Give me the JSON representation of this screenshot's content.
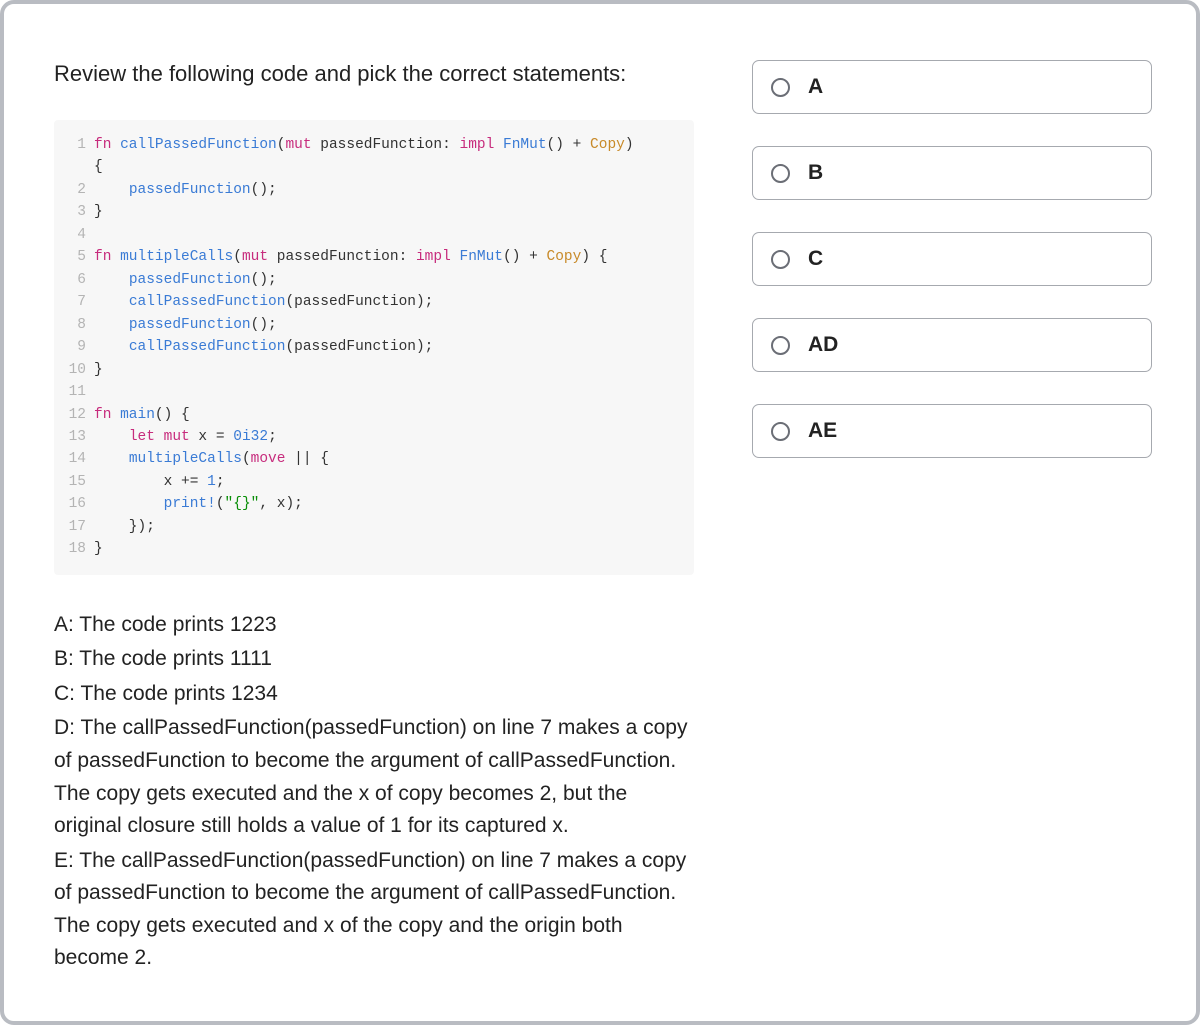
{
  "question": "Review the following code and pick the correct statements:",
  "code": {
    "lines": [
      {
        "n": 1,
        "html": "<span class='kw'>fn</span> <span class='fnname'>callPassedFunction</span>(<span class='kw'>mut</span> <span class='plain'>passedFunction</span>: <span class='kw'>impl</span> <span class='fnname'>FnMut</span>() + <span class='type'>Copy</span>)"
      },
      {
        "n": "",
        "html": "{"
      },
      {
        "n": 2,
        "html": "    <span class='call'>passedFunction</span>();"
      },
      {
        "n": 3,
        "html": "}"
      },
      {
        "n": 4,
        "html": ""
      },
      {
        "n": 5,
        "html": "<span class='kw'>fn</span> <span class='fnname'>multipleCalls</span>(<span class='kw'>mut</span> <span class='plain'>passedFunction</span>: <span class='kw'>impl</span> <span class='fnname'>FnMut</span>() + <span class='type'>Copy</span>) {"
      },
      {
        "n": 6,
        "html": "    <span class='call'>passedFunction</span>();"
      },
      {
        "n": 7,
        "html": "    <span class='call'>callPassedFunction</span>(<span class='plain'>passedFunction</span>);"
      },
      {
        "n": 8,
        "html": "    <span class='call'>passedFunction</span>();"
      },
      {
        "n": 9,
        "html": "    <span class='call'>callPassedFunction</span>(<span class='plain'>passedFunction</span>);"
      },
      {
        "n": 10,
        "html": "}"
      },
      {
        "n": 11,
        "html": ""
      },
      {
        "n": 12,
        "html": "<span class='kw'>fn</span> <span class='fnname'>main</span>() {"
      },
      {
        "n": 13,
        "html": "    <span class='kw'>let</span> <span class='kw'>mut</span> x = <span class='num'>0i32</span>;"
      },
      {
        "n": 14,
        "html": "    <span class='call'>multipleCalls</span>(<span class='kw'>move</span> || {"
      },
      {
        "n": 15,
        "html": "        x += <span class='num'>1</span>;"
      },
      {
        "n": 16,
        "html": "        <span class='macro'>print!</span>(<span class='str'>\"{}\"</span>, x);"
      },
      {
        "n": 17,
        "html": "    });"
      },
      {
        "n": 18,
        "html": "}"
      }
    ]
  },
  "statements": [
    "A: The code prints 1223",
    "B: The code prints 1111",
    "C: The code prints 1234",
    "D: The callPassedFunction(passedFunction) on line 7 makes a copy of passedFunction to become the argument of callPassedFunction. The copy gets executed and the x of copy becomes 2, but the original closure still holds a value of 1 for its captured x.",
    "E: The callPassedFunction(passedFunction) on line 7 makes a copy of passedFunction to become the argument of callPassedFunction. The copy gets executed and x of the copy and the origin both become 2."
  ],
  "options": [
    {
      "label": "A"
    },
    {
      "label": "B"
    },
    {
      "label": "C"
    },
    {
      "label": "AD"
    },
    {
      "label": "AE"
    }
  ]
}
